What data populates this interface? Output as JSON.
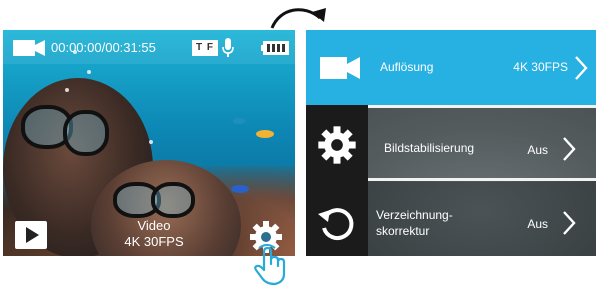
{
  "live_view": {
    "timer": "00:00:00/00:31:55",
    "tf_badge": "T F",
    "mode_label": "Video",
    "mode_value": "4K 30FPS",
    "icons": [
      "video-camera-icon",
      "sd-card-icon",
      "microphone-icon",
      "battery-icon",
      "play-icon",
      "gear-icon",
      "tap-hand-icon",
      "curved-arrow-icon"
    ]
  },
  "settings_menu": {
    "items": [
      {
        "label": "Auflösung",
        "value": "4K 30FPS",
        "active": true
      },
      {
        "label": "Bildstabilisierung",
        "value": "Aus",
        "active": false
      },
      {
        "label_line1": "Verzeichnung-",
        "label_line2": "skorrektur",
        "value": "Aus",
        "active": false
      }
    ],
    "sidebar_icons": [
      "gear-icon",
      "back-icon"
    ]
  },
  "colors": {
    "accent": "#27b0e2",
    "sidebar": "#1b1b1b",
    "text": "#ffffff"
  }
}
